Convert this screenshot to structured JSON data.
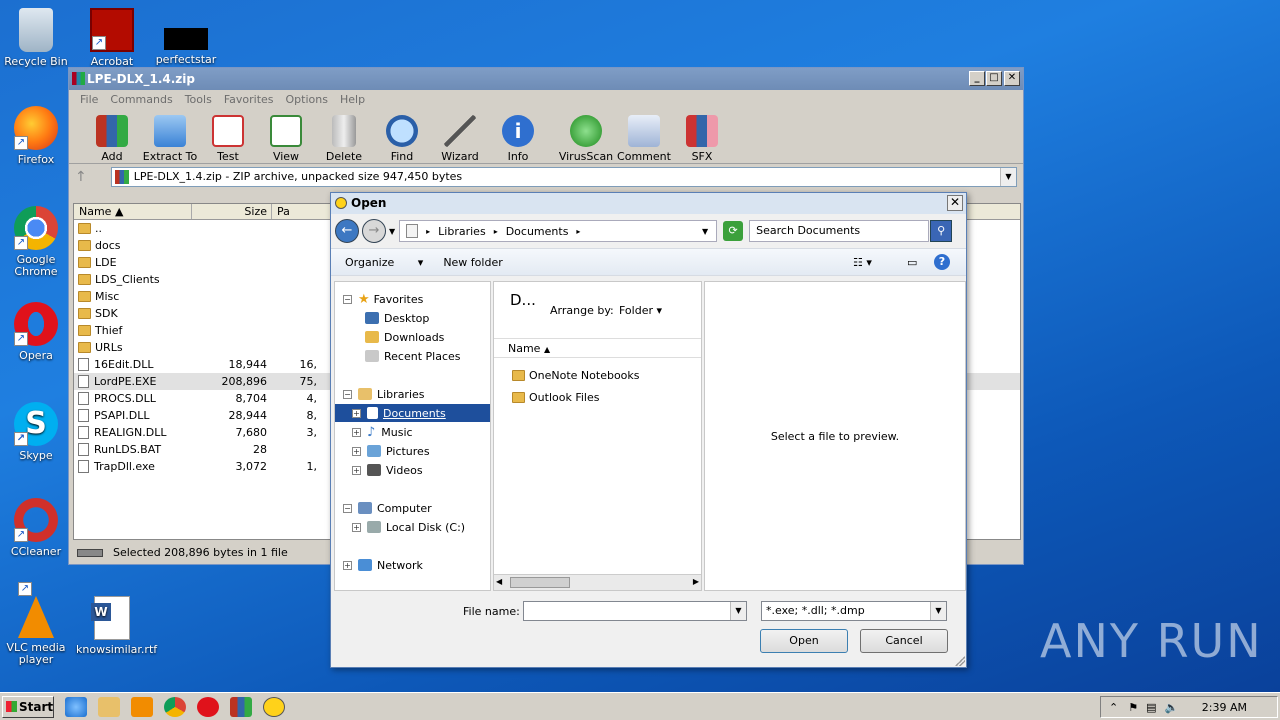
{
  "desktop": {
    "icons": [
      {
        "label": "Recycle Bin"
      },
      {
        "label": "Acrobat"
      },
      {
        "label": "perfectstar"
      },
      {
        "label": "Firefox"
      },
      {
        "label": "Google Chrome"
      },
      {
        "label": "Opera"
      },
      {
        "label": "Skype"
      },
      {
        "label": "CCleaner"
      },
      {
        "label": "VLC media player"
      },
      {
        "label": "knowsimilar.rtf"
      }
    ],
    "watermark": "ANY RUN"
  },
  "winrar": {
    "title": "LPE-DLX_1.4.zip",
    "menu": [
      "File",
      "Commands",
      "Tools",
      "Favorites",
      "Options",
      "Help"
    ],
    "toolbar": [
      "Add",
      "Extract To",
      "Test",
      "View",
      "Delete",
      "Find",
      "Wizard",
      "Info",
      "VirusScan",
      "Comment",
      "SFX"
    ],
    "address": "LPE-DLX_1.4.zip - ZIP archive, unpacked size 947,450 bytes",
    "columns": [
      "Name",
      "Size",
      "Pa"
    ],
    "rows": [
      {
        "name": "..",
        "size": "",
        "packed": ""
      },
      {
        "name": "docs",
        "size": "",
        "packed": ""
      },
      {
        "name": "LDE",
        "size": "",
        "packed": ""
      },
      {
        "name": "LDS_Clients",
        "size": "",
        "packed": ""
      },
      {
        "name": "Misc",
        "size": "",
        "packed": ""
      },
      {
        "name": "SDK",
        "size": "",
        "packed": ""
      },
      {
        "name": "Thief",
        "size": "",
        "packed": ""
      },
      {
        "name": "URLs",
        "size": "",
        "packed": ""
      },
      {
        "name": "16Edit.DLL",
        "size": "18,944",
        "packed": "16,"
      },
      {
        "name": "LordPE.EXE",
        "size": "208,896",
        "packed": "75,"
      },
      {
        "name": "PROCS.DLL",
        "size": "8,704",
        "packed": "4,"
      },
      {
        "name": "PSAPI.DLL",
        "size": "28,944",
        "packed": "8,"
      },
      {
        "name": "REALIGN.DLL",
        "size": "7,680",
        "packed": "3,"
      },
      {
        "name": "RunLDS.BAT",
        "size": "28",
        "packed": ""
      },
      {
        "name": "TrapDll.exe",
        "size": "3,072",
        "packed": "1,"
      }
    ],
    "status": "Selected 208,896 bytes in 1 file"
  },
  "dialog": {
    "title": "Open",
    "breadcrumb": [
      "Libraries",
      "Documents"
    ],
    "search_placeholder": "Search Documents",
    "organize": "Organize",
    "new_folder": "New folder",
    "nav": {
      "favorites": "Favorites",
      "desktop": "Desktop",
      "downloads": "Downloads",
      "recent": "Recent Places",
      "libraries": "Libraries",
      "documents": "Documents",
      "music": "Music",
      "pictures": "Pictures",
      "videos": "Videos",
      "computer": "Computer",
      "local_disk": "Local Disk (C:)",
      "network": "Network"
    },
    "lib_title": "D...",
    "arrange_by": "Arrange by:",
    "arrange_value": "Folder",
    "name_col": "Name",
    "items": [
      "OneNote Notebooks",
      "Outlook Files"
    ],
    "preview_text": "Select a file to preview.",
    "file_name_label": "File name:",
    "file_name_value": "",
    "filter": "*.exe; *.dll; *.dmp",
    "open_btn": "Open",
    "cancel_btn": "Cancel"
  },
  "taskbar": {
    "start": "Start",
    "clock": "2:39 AM"
  }
}
